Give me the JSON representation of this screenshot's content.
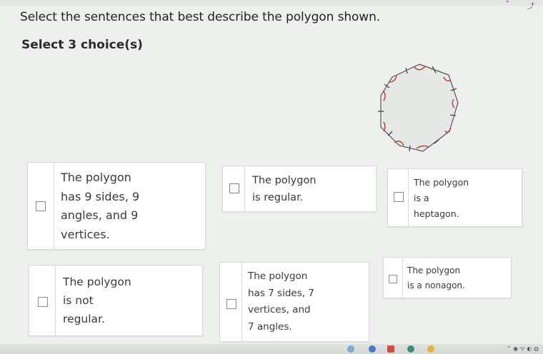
{
  "question": "Select the sentences that best describe the polygon shown.",
  "prompt": "Select 3 choice(s)",
  "choices": [
    {
      "lines": [
        "The polygon",
        "has 9 sides, 9",
        "angles, and 9",
        "vertices."
      ]
    },
    {
      "lines": [
        "The polygon",
        "is regular."
      ]
    },
    {
      "lines": [
        "The polygon",
        "is a",
        "heptagon."
      ]
    },
    {
      "lines": [
        "The polygon",
        "is not",
        "regular."
      ]
    },
    {
      "lines": [
        "The polygon",
        "has 7 sides, 7",
        "vertices, and",
        "7 angles."
      ]
    },
    {
      "lines": [
        "The polygon",
        "is a nonagon."
      ]
    }
  ],
  "colors": {
    "tick_marks": "#4a4a4a",
    "angle_arcs": "#c0392b",
    "polygon_fill": "#e5e7e5"
  },
  "icons": [
    "minimize-icon",
    "restore-icon"
  ]
}
